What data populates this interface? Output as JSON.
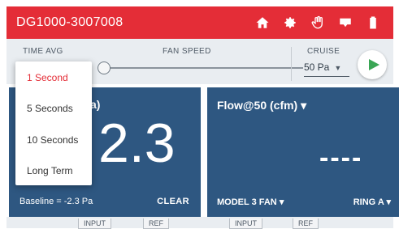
{
  "header": {
    "title": "DG1000-3007008",
    "icons": [
      "home-icon",
      "gear-icon",
      "hand-icon",
      "wifi-icon",
      "battery-icon"
    ],
    "bg_color": "#e42d37"
  },
  "controls": {
    "time_avg_label": "TIME AVG",
    "fan_speed_label": "FAN SPEED",
    "cruise_label": "CRUISE",
    "cruise_value": "50 Pa",
    "play_color": "#3aa655",
    "fan_speed_level": 0
  },
  "dropdown": {
    "items": [
      "1 Second",
      "5 Seconds",
      "10 Seconds",
      "Long Term"
    ],
    "selected": "1 Second"
  },
  "left_panel": {
    "header_partial": "a)",
    "value": "2.3",
    "baseline": "Baseline = -2.3 Pa",
    "clear": "CLEAR"
  },
  "right_panel": {
    "header": "Flow@50 (cfm)",
    "value": "----",
    "model_fan": "MODEL 3 FAN",
    "ring": "RING A"
  },
  "bottom_tabs": [
    "INPUT",
    "REF",
    "INPUT",
    "REF"
  ]
}
